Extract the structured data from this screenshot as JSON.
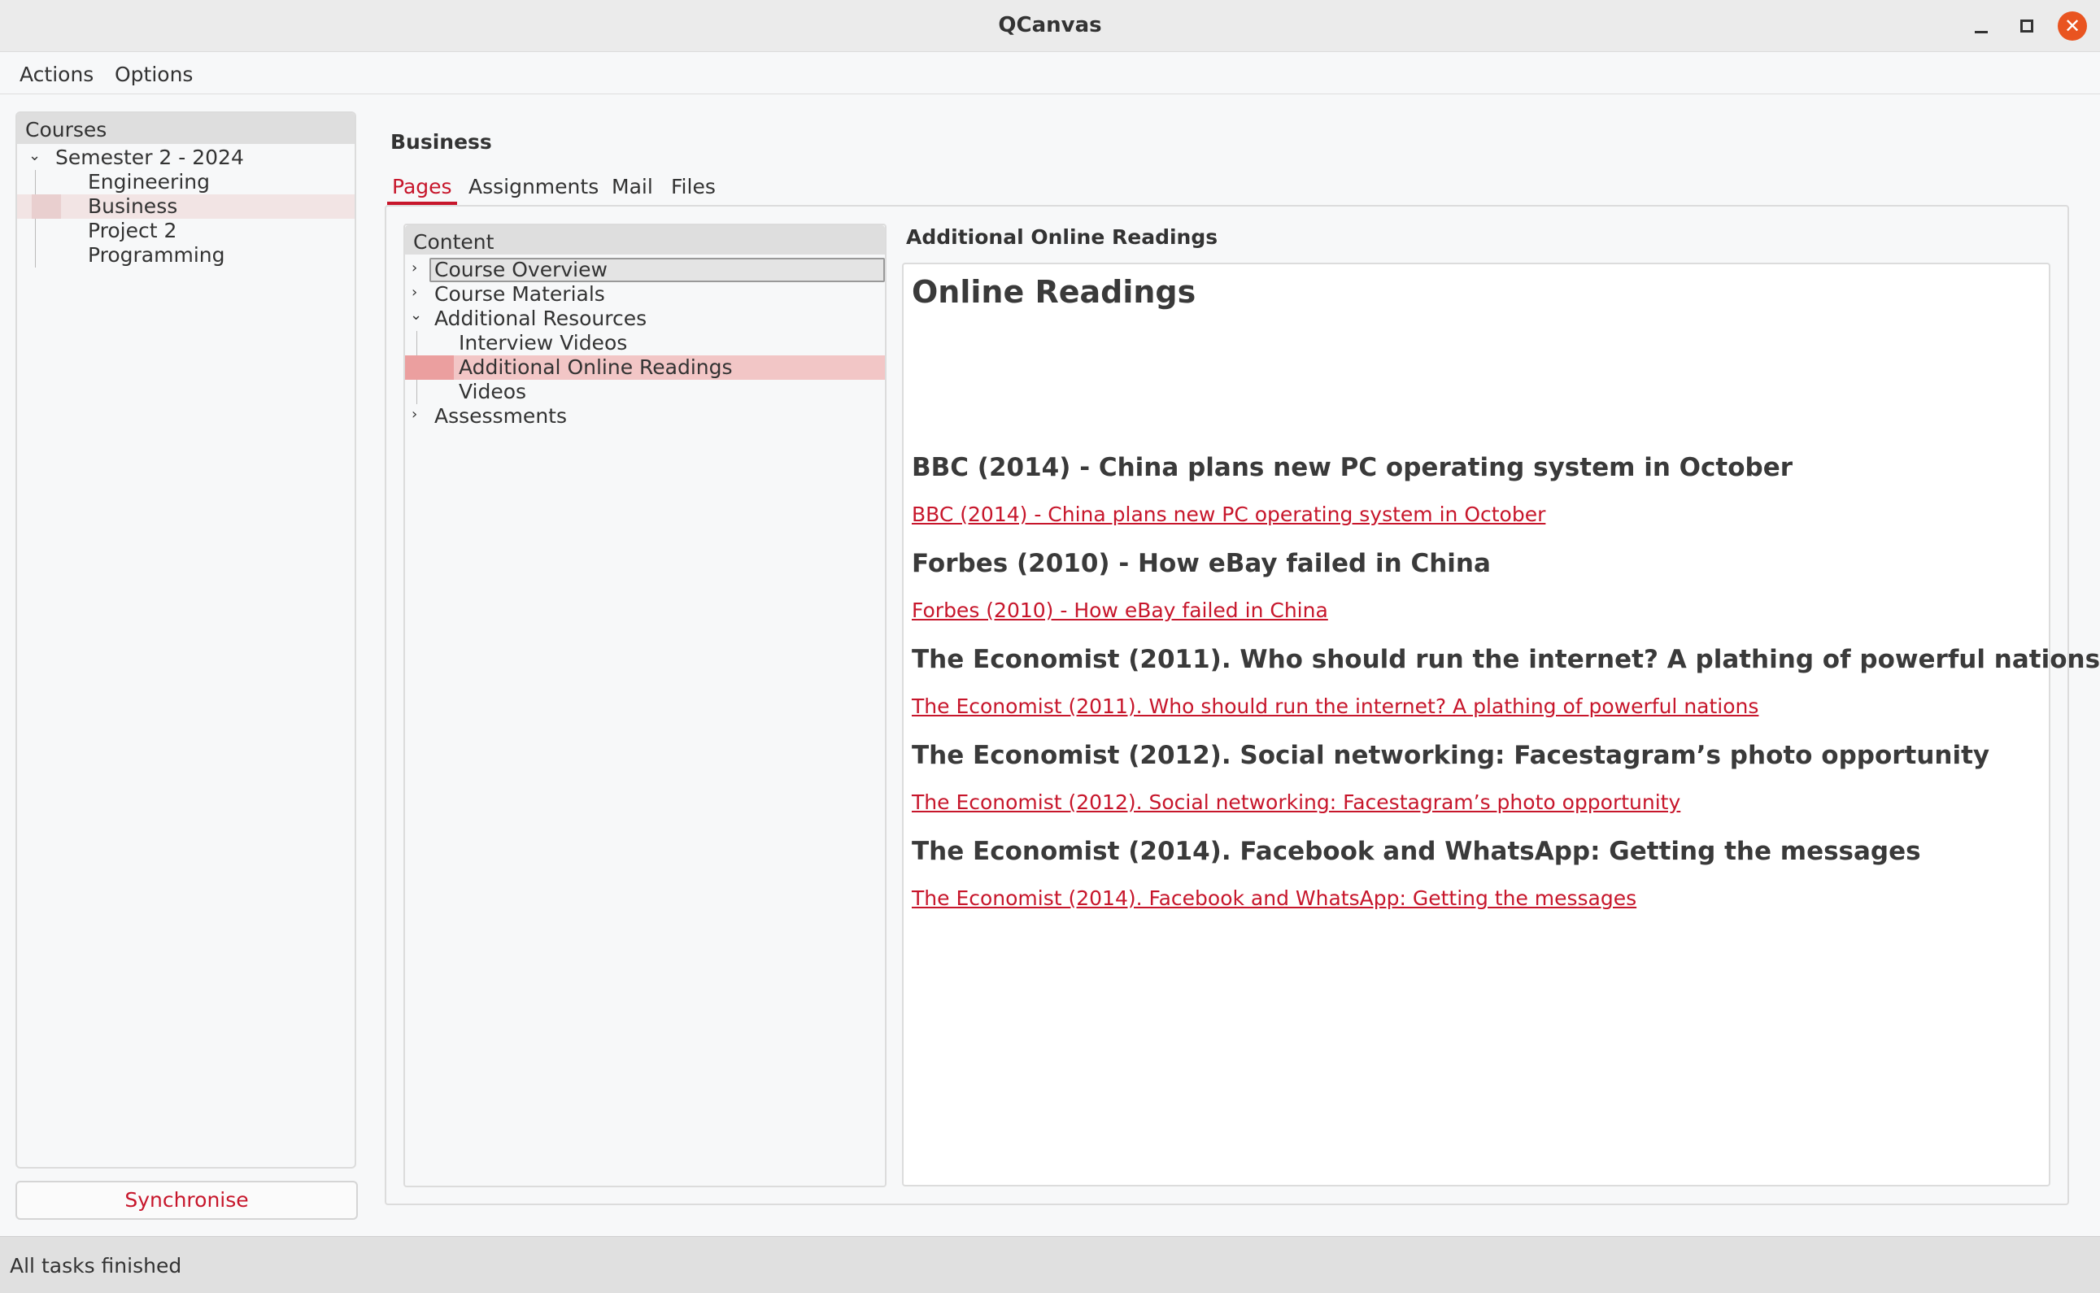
{
  "window": {
    "title": "QCanvas"
  },
  "menu": {
    "actions": "Actions",
    "options": "Options"
  },
  "courses": {
    "header": "Courses",
    "semester": "Semester 2 - 2024",
    "items": [
      "Engineering",
      "Business",
      "Project 2",
      "Programming"
    ],
    "selected": "Business"
  },
  "sync_button": "Synchronise",
  "course_title": "Business",
  "tabs": [
    "Pages",
    "Assignments",
    "Mail",
    "Files"
  ],
  "active_tab": "Pages",
  "content": {
    "header": "Content",
    "items": [
      "Course Overview",
      "Course Materials",
      "Additional Resources",
      "Interview Videos",
      "Additional Online Readings",
      "Videos",
      "Assessments"
    ],
    "selected": "Additional Online Readings"
  },
  "page": {
    "title": "Additional Online Readings",
    "heading": "Online Readings",
    "readings": [
      {
        "heading": "BBC (2014) - China plans new PC operating system in October",
        "link": "BBC (2014) - China plans new PC operating system in October"
      },
      {
        "heading": "Forbes (2010) - How eBay failed in China",
        "link": "Forbes (2010) - How eBay failed in China"
      },
      {
        "heading": "The Economist (2011). Who should run the internet? A plathing of powerful nations",
        "link": "The Economist (2011). Who should run the internet? A plathing of powerful nations"
      },
      {
        "heading": "The Economist (2012). Social networking: Facestagram’s photo opportunity",
        "link": "The Economist (2012). Social networking: Facestagram’s photo opportunity"
      },
      {
        "heading": "The Economist (2014). Facebook and WhatsApp: Getting the messages",
        "link": "The Economist (2014). Facebook and WhatsApp: Getting the messages"
      }
    ]
  },
  "status": "All tasks finished",
  "colors": {
    "accent": "#c7162b",
    "close": "#e95420",
    "selection": "#f2c6c6"
  }
}
